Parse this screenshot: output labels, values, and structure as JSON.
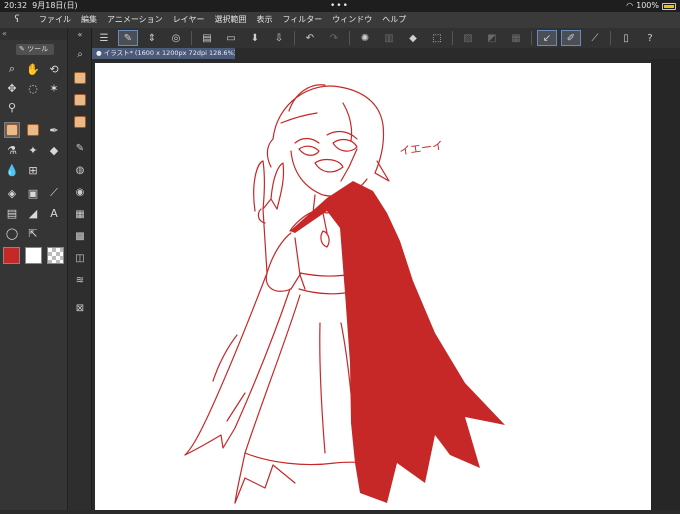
{
  "status": {
    "time": "20:32",
    "date": "9月18日(日)",
    "dots": "•••",
    "battery": "100%"
  },
  "menu": {
    "items": [
      "ファイル",
      "編集",
      "アニメーション",
      "レイヤー",
      "選択範囲",
      "表示",
      "フィルター",
      "ウィンドウ",
      "ヘルプ"
    ]
  },
  "tools": {
    "panel_title": "ツール"
  },
  "document": {
    "tab_title": "● イラスト* (1600 x 1200px 72dpi 128.6%)"
  },
  "canvas": {
    "annotation_text": "イエーイ",
    "colors": {
      "main": "#c62828",
      "sub": "#ffffff",
      "line": "#c62828"
    }
  }
}
